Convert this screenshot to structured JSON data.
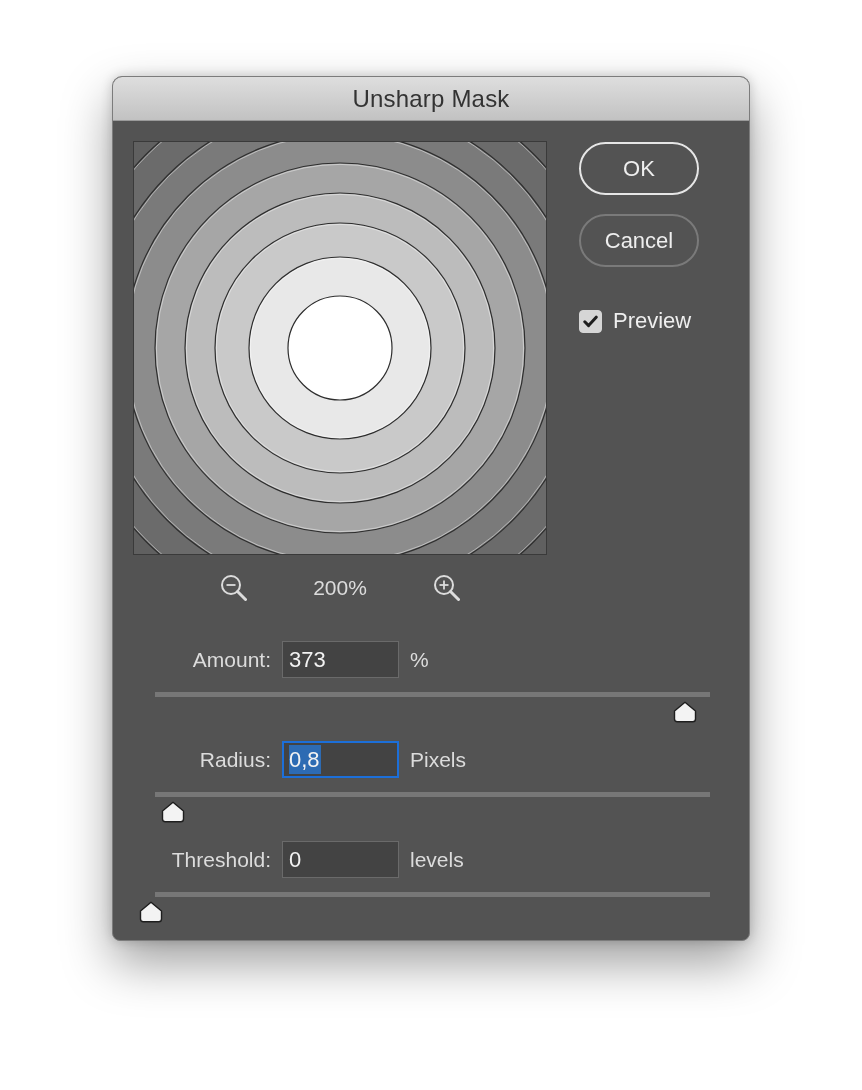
{
  "window": {
    "title": "Unsharp Mask"
  },
  "zoom": {
    "readout": "200%"
  },
  "buttons": [
    {
      "label": "OK",
      "default": true
    },
    {
      "label": "Cancel",
      "default": false
    }
  ],
  "preview": {
    "label": "Preview",
    "checked": true
  },
  "params": [
    {
      "label": "Amount:",
      "value": "373",
      "unit": "%",
      "focused": false,
      "level": 0.962
    },
    {
      "label": "Radius:",
      "value": "0,8",
      "unit": "Pixels",
      "focused": true,
      "level": 0.04
    },
    {
      "label": "Threshold:",
      "value": "0",
      "unit": "levels",
      "focused": false,
      "level": 0
    }
  ]
}
